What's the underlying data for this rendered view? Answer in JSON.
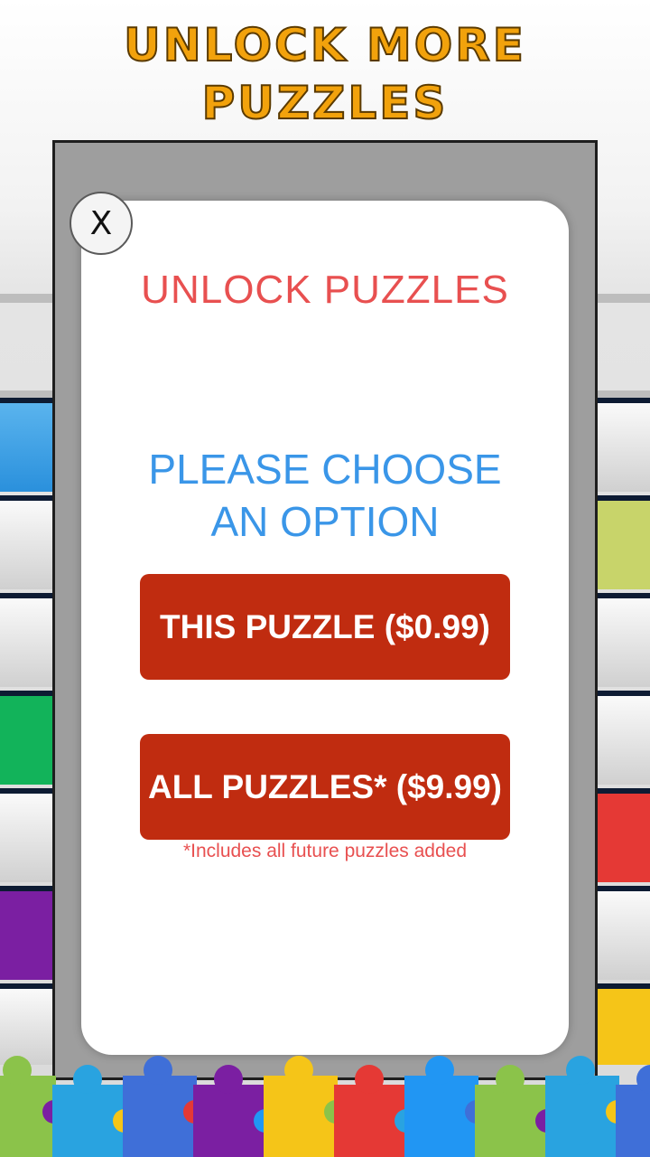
{
  "header": {
    "title": "UNLOCK MORE PUZZLES"
  },
  "dialog": {
    "close_label": "X",
    "title": "UNLOCK PUZZLES",
    "prompt": "PLEASE CHOOSE AN OPTION",
    "option_one": "THIS PUZZLE ($0.99)",
    "option_all": "ALL PUZZLES* ($9.99)",
    "footnote": "*Includes all future puzzles added"
  },
  "colors": {
    "title_gold": "#f2a20c",
    "dialog_title_red": "#e85050",
    "prompt_blue": "#3a96e8",
    "button_red": "#c02c10",
    "piece_colors": [
      "#8bc34a",
      "#29a3e0",
      "#3f6fd8",
      "#7b1fa2",
      "#f5c518",
      "#e53935",
      "#2196f3"
    ]
  }
}
